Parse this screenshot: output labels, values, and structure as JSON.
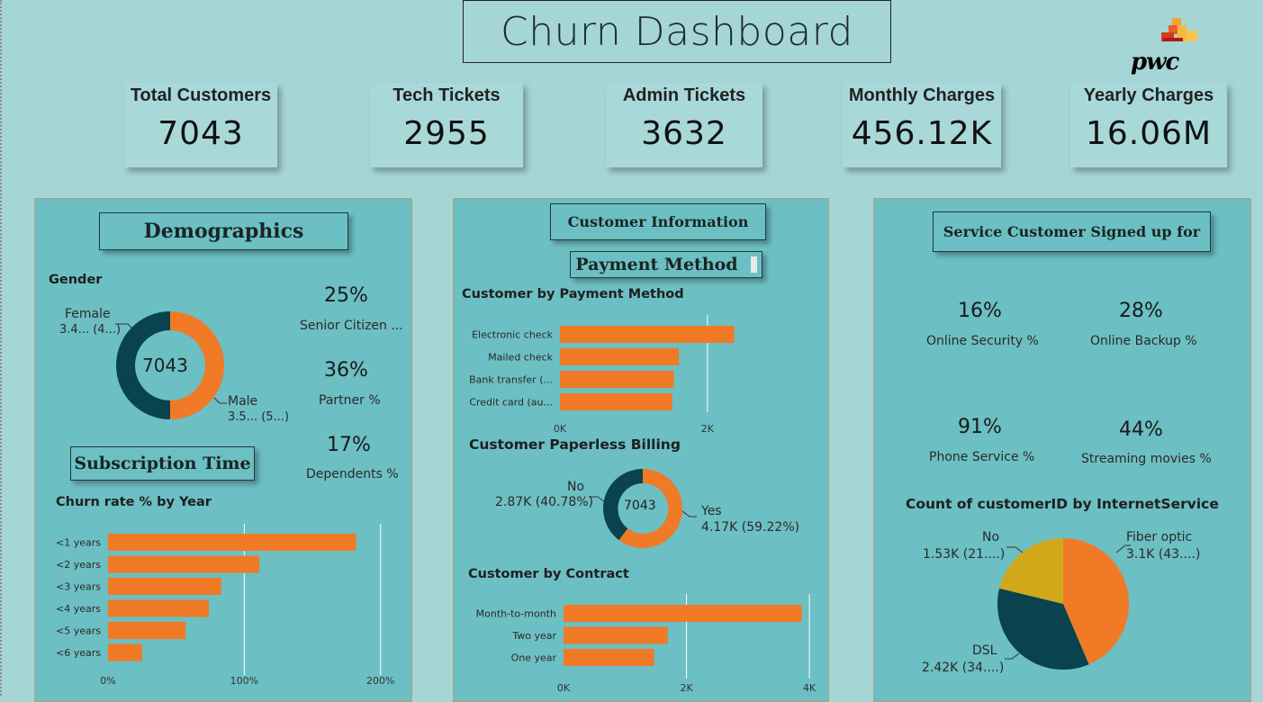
{
  "dashboard": {
    "title": "Churn Dashboard",
    "logo_text": "pwc"
  },
  "kpis": [
    {
      "label": "Total Customers",
      "value": "7043"
    },
    {
      "label": "Tech Tickets",
      "value": "2955"
    },
    {
      "label": "Admin Tickets",
      "value": "3632"
    },
    {
      "label": "Monthly Charges",
      "value": "456.12K"
    },
    {
      "label": "Yearly Charges",
      "value": "16.06M"
    }
  ],
  "demographics": {
    "header": "Demographics",
    "gender_title": "Gender",
    "donut_center": "7043",
    "female_label": "Female",
    "female_value": "3.4... (4...)",
    "male_label": "Male",
    "male_value": "3.5... (5...)",
    "stats": [
      {
        "value": "25%",
        "label": "Senior Citizen ..."
      },
      {
        "value": "36%",
        "label": "Partner %"
      },
      {
        "value": "17%",
        "label": "Dependents %"
      }
    ],
    "subscription_header": "Subscription Time",
    "churn_title": "Churn rate % by Year"
  },
  "customer_info": {
    "header": "Customer Information",
    "payment_header": "Payment Method",
    "payment_title": "Customer by Payment Method",
    "paperless_title": "Customer Paperless Billing",
    "paperless_center": "7043",
    "paperless_no_label": "No",
    "paperless_no_value": "2.87K (40.78%)",
    "paperless_yes_label": "Yes",
    "paperless_yes_value": "4.17K (59.22%)",
    "contract_title": "Customer by Contract"
  },
  "services": {
    "header": "Service Customer Signed up for",
    "stats": [
      {
        "value": "16%",
        "label": "Online Security  %"
      },
      {
        "value": "28%",
        "label": "Online Backup  %"
      },
      {
        "value": "91%",
        "label": "Phone Service  %"
      },
      {
        "value": "44%",
        "label": "Streaming movies %"
      }
    ],
    "internet_title": "Count of customerID by InternetService",
    "no_label": "No",
    "no_value": "1.53K (21....)",
    "fiber_label": "Fiber optic",
    "fiber_value": "3.1K (43....)",
    "dsl_label": "DSL",
    "dsl_value": "2.42K (34....)"
  },
  "colors": {
    "orange": "#f07a26",
    "dark_teal": "#08434f",
    "mustard": "#d1a81a",
    "panel": "#6cbfc3",
    "background": "#a6d5d6"
  },
  "chart_data": [
    {
      "type": "pie",
      "title": "Gender",
      "categories": [
        "Female",
        "Male"
      ],
      "values": [
        3488,
        3555
      ],
      "donut": true
    },
    {
      "type": "bar",
      "title": "Churn rate % by Year",
      "orientation": "horizontal",
      "categories": [
        "<1 years",
        "<2 years",
        "<3 years",
        "<4 years",
        "<5 years",
        "<6 years"
      ],
      "values": [
        182,
        111,
        83,
        74,
        57,
        25
      ],
      "xlim": [
        0,
        220
      ],
      "xticks": [
        "0%",
        "100%",
        "200%"
      ]
    },
    {
      "type": "bar",
      "title": "Customer by Payment Method",
      "orientation": "horizontal",
      "categories": [
        "Electronic check",
        "Mailed check",
        "Bank transfer (...",
        "Credit card (au..."
      ],
      "values": [
        2365,
        1612,
        1544,
        1522
      ],
      "xlim": [
        0,
        2600
      ],
      "xticks": [
        "0K",
        "2K"
      ]
    },
    {
      "type": "pie",
      "title": "Customer Paperless Billing",
      "categories": [
        "No",
        "Yes"
      ],
      "values": [
        2870,
        4170
      ],
      "donut": true
    },
    {
      "type": "bar",
      "title": "Customer by Contract",
      "orientation": "horizontal",
      "categories": [
        "Month-to-month",
        "Two year",
        "One year"
      ],
      "values": [
        3875,
        1695,
        1473
      ],
      "xlim": [
        0,
        4100
      ],
      "xticks": [
        "0K",
        "2K",
        "4K"
      ]
    },
    {
      "type": "pie",
      "title": "Count of customerID by InternetService",
      "categories": [
        "Fiber optic",
        "DSL",
        "No"
      ],
      "values": [
        3100,
        2420,
        1530
      ]
    }
  ]
}
